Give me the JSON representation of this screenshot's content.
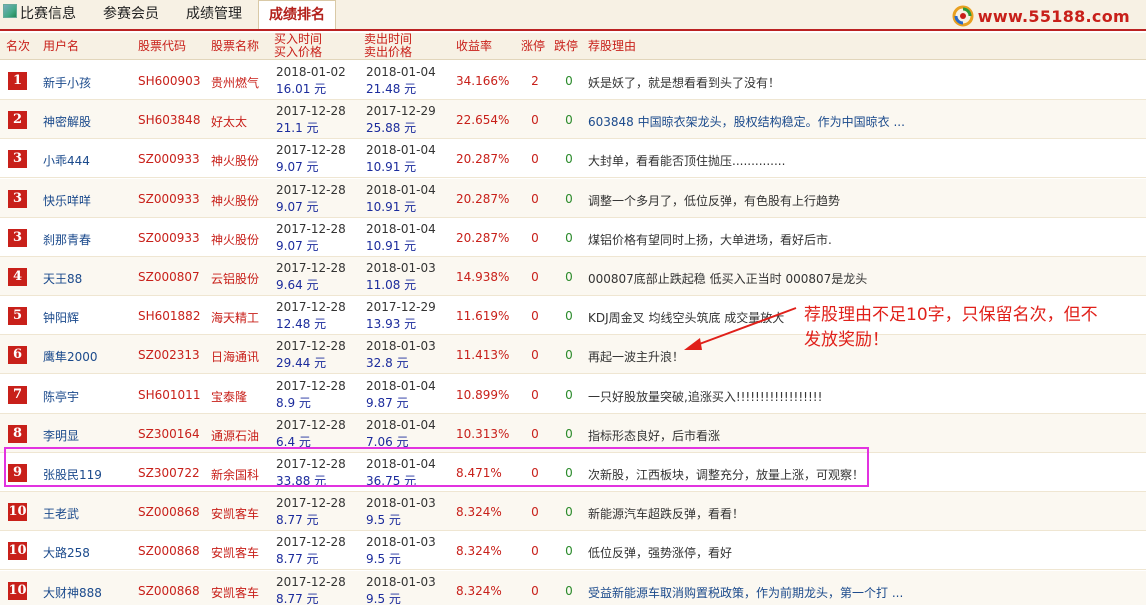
{
  "nav": {
    "items": [
      {
        "label": "比赛信息"
      },
      {
        "label": "参赛会员"
      },
      {
        "label": "成绩管理"
      },
      {
        "label": "成绩排名"
      }
    ],
    "site_url": "www.55188.com"
  },
  "table": {
    "headers": {
      "rank": "名次",
      "user": "用户名",
      "code": "股票代码",
      "name": "股票名称",
      "buy_l1": "买入时间",
      "buy_l2": "买入价格",
      "sell_l1": "卖出时间",
      "sell_l2": "卖出价格",
      "pct": "收益率",
      "up": "涨停",
      "down": "跌停",
      "reason": "荐股理由"
    },
    "rows": [
      {
        "rank": "1",
        "user": "新手小孩",
        "code": "SH600903",
        "name": "贵州燃气",
        "buy_date": "2018-01-02",
        "buy_price": "16.01 元",
        "sell_date": "2018-01-04",
        "sell_price": "21.48 元",
        "pct": "34.166%",
        "up": "2",
        "down": "0",
        "reason": "妖是妖了，就是想看看到头了没有！",
        "reason_link": false
      },
      {
        "rank": "2",
        "user": "神密解股",
        "code": "SH603848",
        "name": "好太太",
        "buy_date": "2017-12-28",
        "buy_price": "21.1 元",
        "sell_date": "2017-12-29",
        "sell_price": "25.88 元",
        "pct": "22.654%",
        "up": "0",
        "down": "0",
        "reason": "603848 中国晾衣架龙头，股权结构稳定。作为中国晾衣 ...",
        "reason_link": true
      },
      {
        "rank": "3",
        "user": "小乖444",
        "code": "SZ000933",
        "name": "神火股份",
        "buy_date": "2017-12-28",
        "buy_price": "9.07 元",
        "sell_date": "2018-01-04",
        "sell_price": "10.91 元",
        "pct": "20.287%",
        "up": "0",
        "down": "0",
        "reason": "大封单，看看能否顶住抛压..............",
        "reason_link": false
      },
      {
        "rank": "3",
        "user": "快乐咩咩",
        "code": "SZ000933",
        "name": "神火股份",
        "buy_date": "2017-12-28",
        "buy_price": "9.07 元",
        "sell_date": "2018-01-04",
        "sell_price": "10.91 元",
        "pct": "20.287%",
        "up": "0",
        "down": "0",
        "reason": "调整一个多月了，低位反弹，有色股有上行趋势",
        "reason_link": false
      },
      {
        "rank": "3",
        "user": "刹那青春",
        "code": "SZ000933",
        "name": "神火股份",
        "buy_date": "2017-12-28",
        "buy_price": "9.07 元",
        "sell_date": "2018-01-04",
        "sell_price": "10.91 元",
        "pct": "20.287%",
        "up": "0",
        "down": "0",
        "reason": "煤铝价格有望同时上扬，大单进场，看好后市.",
        "reason_link": false
      },
      {
        "rank": "4",
        "user": "天王88",
        "code": "SZ000807",
        "name": "云铝股份",
        "buy_date": "2017-12-28",
        "buy_price": "9.64 元",
        "sell_date": "2018-01-03",
        "sell_price": "11.08 元",
        "pct": "14.938%",
        "up": "0",
        "down": "0",
        "reason": "000807底部止跌起稳 低买入正当时 000807是龙头",
        "reason_link": false
      },
      {
        "rank": "5",
        "user": "钟阳辉",
        "code": "SH601882",
        "name": "海天精工",
        "buy_date": "2017-12-28",
        "buy_price": "12.48 元",
        "sell_date": "2017-12-29",
        "sell_price": "13.93 元",
        "pct": "11.619%",
        "up": "0",
        "down": "0",
        "reason": "KDJ周金叉 均线空头筑底 成交量放大",
        "reason_link": false
      },
      {
        "rank": "6",
        "user": "鹰隼2000",
        "code": "SZ002313",
        "name": "日海通讯",
        "buy_date": "2017-12-28",
        "buy_price": "29.44 元",
        "sell_date": "2018-01-03",
        "sell_price": "32.8 元",
        "pct": "11.413%",
        "up": "0",
        "down": "0",
        "reason": "再起一波主升浪！",
        "reason_link": false
      },
      {
        "rank": "7",
        "user": "陈亭宇",
        "code": "SH601011",
        "name": "宝泰隆",
        "buy_date": "2017-12-28",
        "buy_price": "8.9 元",
        "sell_date": "2018-01-04",
        "sell_price": "9.87 元",
        "pct": "10.899%",
        "up": "0",
        "down": "0",
        "reason": "一只好股放量突破,追涨买入!!!!!!!!!!!!!!!!!!",
        "reason_link": false
      },
      {
        "rank": "8",
        "user": "李明显",
        "code": "SZ300164",
        "name": "通源石油",
        "buy_date": "2017-12-28",
        "buy_price": "6.4 元",
        "sell_date": "2018-01-04",
        "sell_price": "7.06 元",
        "pct": "10.313%",
        "up": "0",
        "down": "0",
        "reason": "指标形态良好，后市看涨",
        "reason_link": false
      },
      {
        "rank": "9",
        "user": "张股民119",
        "code": "SZ300722",
        "name": "新余国科",
        "buy_date": "2017-12-28",
        "buy_price": "33.88 元",
        "sell_date": "2018-01-04",
        "sell_price": "36.75 元",
        "pct": "8.471%",
        "up": "0",
        "down": "0",
        "reason": "次新股，江西板块，调整充分，放量上涨，可观察！",
        "reason_link": false
      },
      {
        "rank": "10",
        "user": "王老武",
        "code": "SZ000868",
        "name": "安凯客车",
        "buy_date": "2017-12-28",
        "buy_price": "8.77 元",
        "sell_date": "2018-01-03",
        "sell_price": "9.5 元",
        "pct": "8.324%",
        "up": "0",
        "down": "0",
        "reason": "新能源汽车超跌反弹，看看！",
        "reason_link": false
      },
      {
        "rank": "10",
        "user": "大路258",
        "code": "SZ000868",
        "name": "安凯客车",
        "buy_date": "2017-12-28",
        "buy_price": "8.77 元",
        "sell_date": "2018-01-03",
        "sell_price": "9.5 元",
        "pct": "8.324%",
        "up": "0",
        "down": "0",
        "reason": "低位反弹，强势涨停，看好",
        "reason_link": false
      },
      {
        "rank": "10",
        "user": "大财神888",
        "code": "SZ000868",
        "name": "安凯客车",
        "buy_date": "2017-12-28",
        "buy_price": "8.77 元",
        "sell_date": "2018-01-03",
        "sell_price": "9.5 元",
        "pct": "8.324%",
        "up": "0",
        "down": "0",
        "reason": "受益新能源车取消购置税政策，作为前期龙头，第一个打 ...",
        "reason_link": true
      }
    ]
  },
  "annotation": {
    "line1": "荐股理由不足10字，只保留名次，但不",
    "line2": "发放奖励！"
  },
  "colors": {
    "accent": "#c8201a",
    "highlight": "#e233e0",
    "link": "#1b4a8c"
  }
}
